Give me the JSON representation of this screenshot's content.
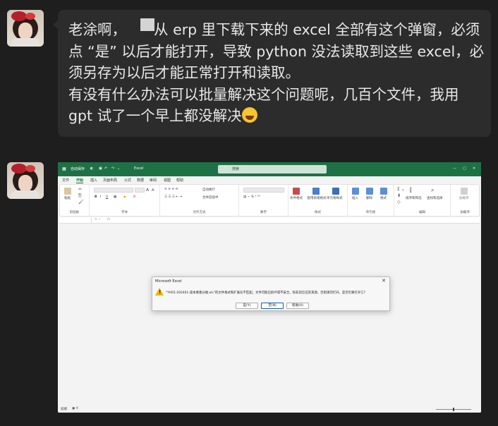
{
  "message1": {
    "text": "老涂啊，      从 erp 里下载下来的 excel 全部有这个弹窗，必须点 “是” 以后才能打开，导致 python 没法读取到这些 excel，必须另存为以后才能正常打开和读取。\n有没有什么办法可以批量解决这个问题呢，几百个文件，我用 gpt 试了一个早上都没解决"
  },
  "excel": {
    "autosave": "自动保存",
    "app_name": "Excel",
    "search_placeholder": "搜索",
    "menu": [
      "文件",
      "开始",
      "插入",
      "页面布局",
      "公式",
      "数据",
      "审阅",
      "视图",
      "帮助"
    ],
    "ribbon_groups": [
      "剪贴板",
      "字体",
      "对齐方式",
      "数字",
      "样式",
      "单元格",
      "编辑",
      "加载项"
    ],
    "ribbon_labels": {
      "paste": "粘贴",
      "wrap_text": "自动换行",
      "merge_center": "合并后居中",
      "cond_format": "条件格式",
      "format_table": "套用表格格式",
      "cell_style": "单元格样式",
      "insert": "插入",
      "delete": "删除",
      "format": "格式",
      "sort_filter": "排序和筛选",
      "find_select": "查找和选择",
      "addins": "加载项",
      "font_a_big": "A",
      "font_a_small": "A",
      "bold": "B",
      "italic": "I",
      "underline": "U"
    },
    "formula_fx": "fx",
    "status": {
      "ready": "就绪"
    },
    "dialog": {
      "title": "Microsoft Excel",
      "message": "“YH01-202401-成本要素分摊.xls”的文件格式和扩展名不匹配。文件可能已损坏或不安全。除非您信任其来源，否则请勿打开。是否仍要打开它?",
      "buttons": [
        "是(Y)",
        "否(N)",
        "帮助(H)"
      ]
    }
  },
  "colors": {
    "excel_green": "#1e7145",
    "bubble_bg": "#2c2c2c",
    "page_bg": "#1e1e1e"
  }
}
